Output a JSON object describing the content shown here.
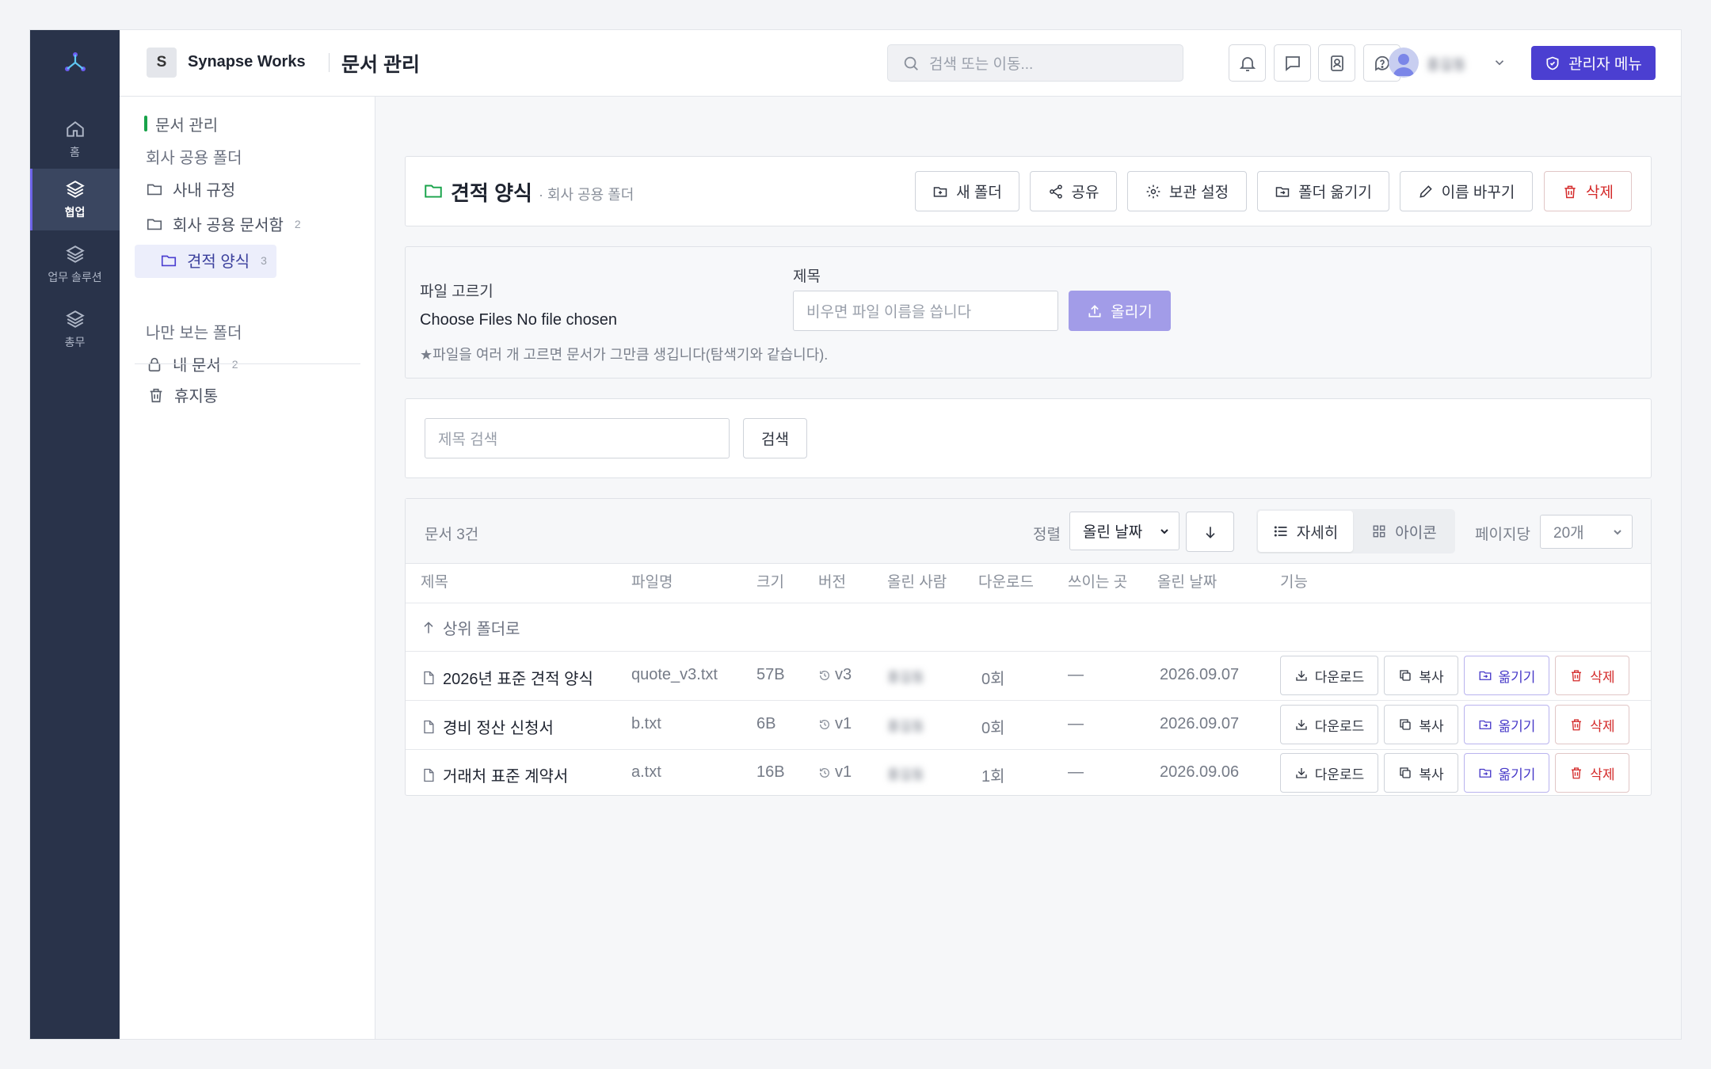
{
  "header": {
    "brand_initial": "S",
    "brand_name": "Synapse Works",
    "page_title": "문서 관리",
    "search_placeholder": "검색 또는 이동...",
    "user_name": "홍길동",
    "admin_label": "관리자 메뉴"
  },
  "rail": {
    "items": [
      {
        "label": "홈",
        "icon": "home-icon"
      },
      {
        "label": "협업",
        "icon": "layers-icon"
      },
      {
        "label": "업무 솔루션",
        "icon": "layers-icon"
      },
      {
        "label": "총무",
        "icon": "layers-icon"
      }
    ],
    "active": "협업"
  },
  "tree": {
    "root_label": "문서 관리",
    "shared_heading": "회사 공용 폴더",
    "folders": [
      {
        "label": "사내 규정",
        "count": ""
      },
      {
        "label": "회사 공용 문서함",
        "count": "2"
      },
      {
        "label": "견적 양식",
        "count": "3"
      }
    ],
    "private_heading": "나만 보는 폴더",
    "my_docs": {
      "label": "내 문서",
      "count": "2"
    },
    "trash_label": "휴지통"
  },
  "folder": {
    "name": "견적 양식",
    "parent": "· 회사 공용 폴더",
    "actions": [
      "새 폴더",
      "공유",
      "보관 설정",
      "폴더 옮기기",
      "이름 바꾸기",
      "삭제"
    ]
  },
  "upload": {
    "file_label": "파일 고르기",
    "file_status": "Choose Files No file chosen",
    "title_label": "제목",
    "title_placeholder": "비우면 파일 이름을 씁니다",
    "submit_label": "올리기",
    "hint": "★파일을 여러 개 고르면 문서가 그만큼 생깁니다(탐색기와 같습니다)."
  },
  "search": {
    "placeholder": "제목 검색",
    "button": "검색"
  },
  "list": {
    "count_label": "문서 3건",
    "sort_label": "정렬",
    "sort_value": "올린 날짜",
    "view_detail": "자세히",
    "view_icon": "아이콘",
    "per_page_label": "페이지당",
    "per_page_value": "20개",
    "columns": [
      "제목",
      "파일명",
      "크기",
      "버전",
      "올린 사람",
      "다운로드",
      "쓰이는 곳",
      "올린 날짜",
      "기능"
    ],
    "parent_row": "상위 폴더로",
    "row_actions": {
      "download": "다운로드",
      "copy": "복사",
      "move": "옮기기",
      "delete": "삭제"
    },
    "rows": [
      {
        "title": "2026년 표준 견적 양식",
        "filename": "quote_v3.txt",
        "size": "57B",
        "version": "v3",
        "uploader": "홍길동",
        "downloads": "0회",
        "usage": "—",
        "date": "2026.09.07"
      },
      {
        "title": "경비 정산 신청서",
        "filename": "b.txt",
        "size": "6B",
        "version": "v1",
        "uploader": "홍길동",
        "downloads": "0회",
        "usage": "—",
        "date": "2026.09.07"
      },
      {
        "title": "거래처 표준 계약서",
        "filename": "a.txt",
        "size": "16B",
        "version": "v1",
        "uploader": "홍길동",
        "downloads": "1회",
        "usage": "—",
        "date": "2026.09.06"
      }
    ]
  },
  "colors": {
    "accent": "#4b3fd1",
    "rail_bg": "#29334a",
    "danger": "#d42a2a",
    "folder_green": "#18a34a"
  }
}
